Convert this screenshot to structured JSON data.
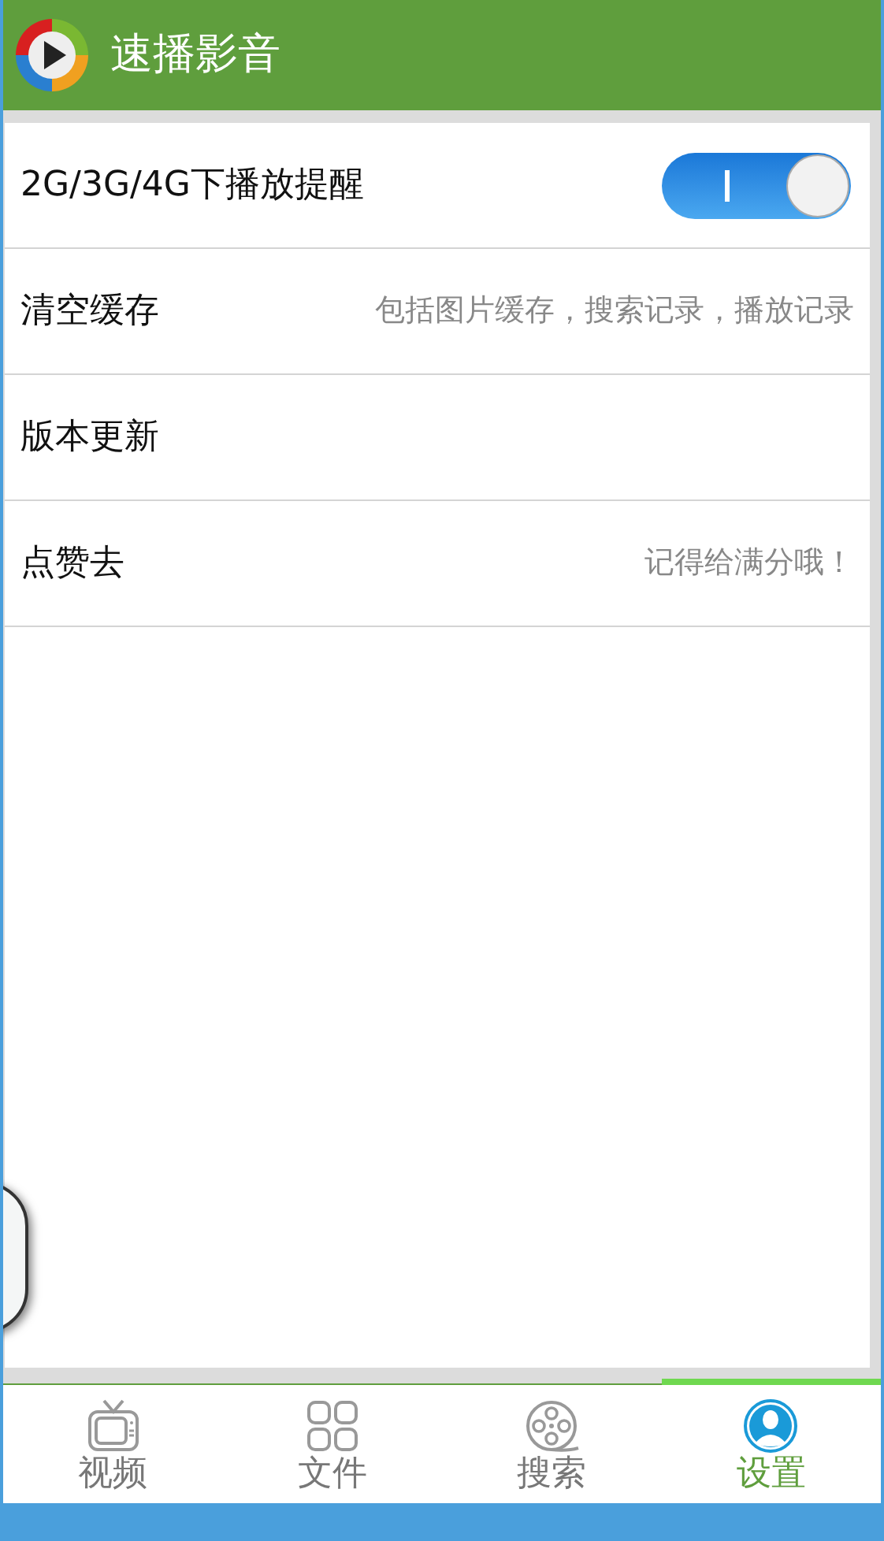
{
  "app_bar": {
    "title": "速播影音"
  },
  "settings": [
    {
      "kind": "toggle",
      "label": "2G/3G/4G下播放提醒",
      "on": true
    },
    {
      "kind": "hint",
      "label": "清空缓存",
      "hint": "包括图片缓存，搜索记录，播放记录"
    },
    {
      "kind": "plain",
      "label": "版本更新"
    },
    {
      "kind": "hint",
      "label": "点赞去",
      "hint": "记得给满分哦！"
    }
  ],
  "tabs": [
    {
      "label": "视频",
      "kind": "tv",
      "selected": false
    },
    {
      "label": "文件",
      "kind": "grid",
      "selected": false
    },
    {
      "label": "搜索",
      "kind": "reel",
      "selected": false
    },
    {
      "label": "设置",
      "kind": "user",
      "selected": true
    }
  ]
}
